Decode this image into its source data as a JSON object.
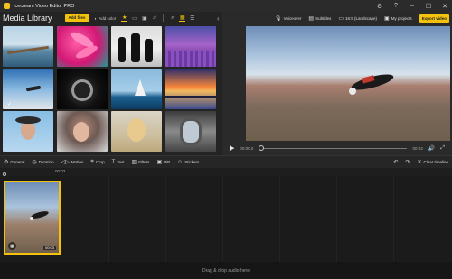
{
  "window": {
    "title": "Icecream Video Editor PRO"
  },
  "media": {
    "title": "Media Library",
    "add_files": "Add files",
    "add_color": "Add color",
    "filter_tabs": [
      "star-icon",
      "video-icon",
      "image-icon",
      "music-icon"
    ]
  },
  "preview": {
    "toolbar": {
      "voiceover": "Voiceover",
      "subtitles": "Subtitles",
      "aspect": "16:9 (Landscape)",
      "projects": "My projects",
      "export": "Export video"
    },
    "time_current": "00:00.0",
    "time_total": "00:03"
  },
  "edit_tools": [
    "General",
    "Duration",
    "Motion",
    "Crop",
    "Text",
    "Filters",
    "PiP",
    "Stickers"
  ],
  "timeline": {
    "clear": "Clear timeline",
    "ruler_label": "00:03",
    "clip_duration": "00:03",
    "audio_drop": "Drag & drop audio here"
  },
  "colors": {
    "accent": "#f4c20d"
  }
}
